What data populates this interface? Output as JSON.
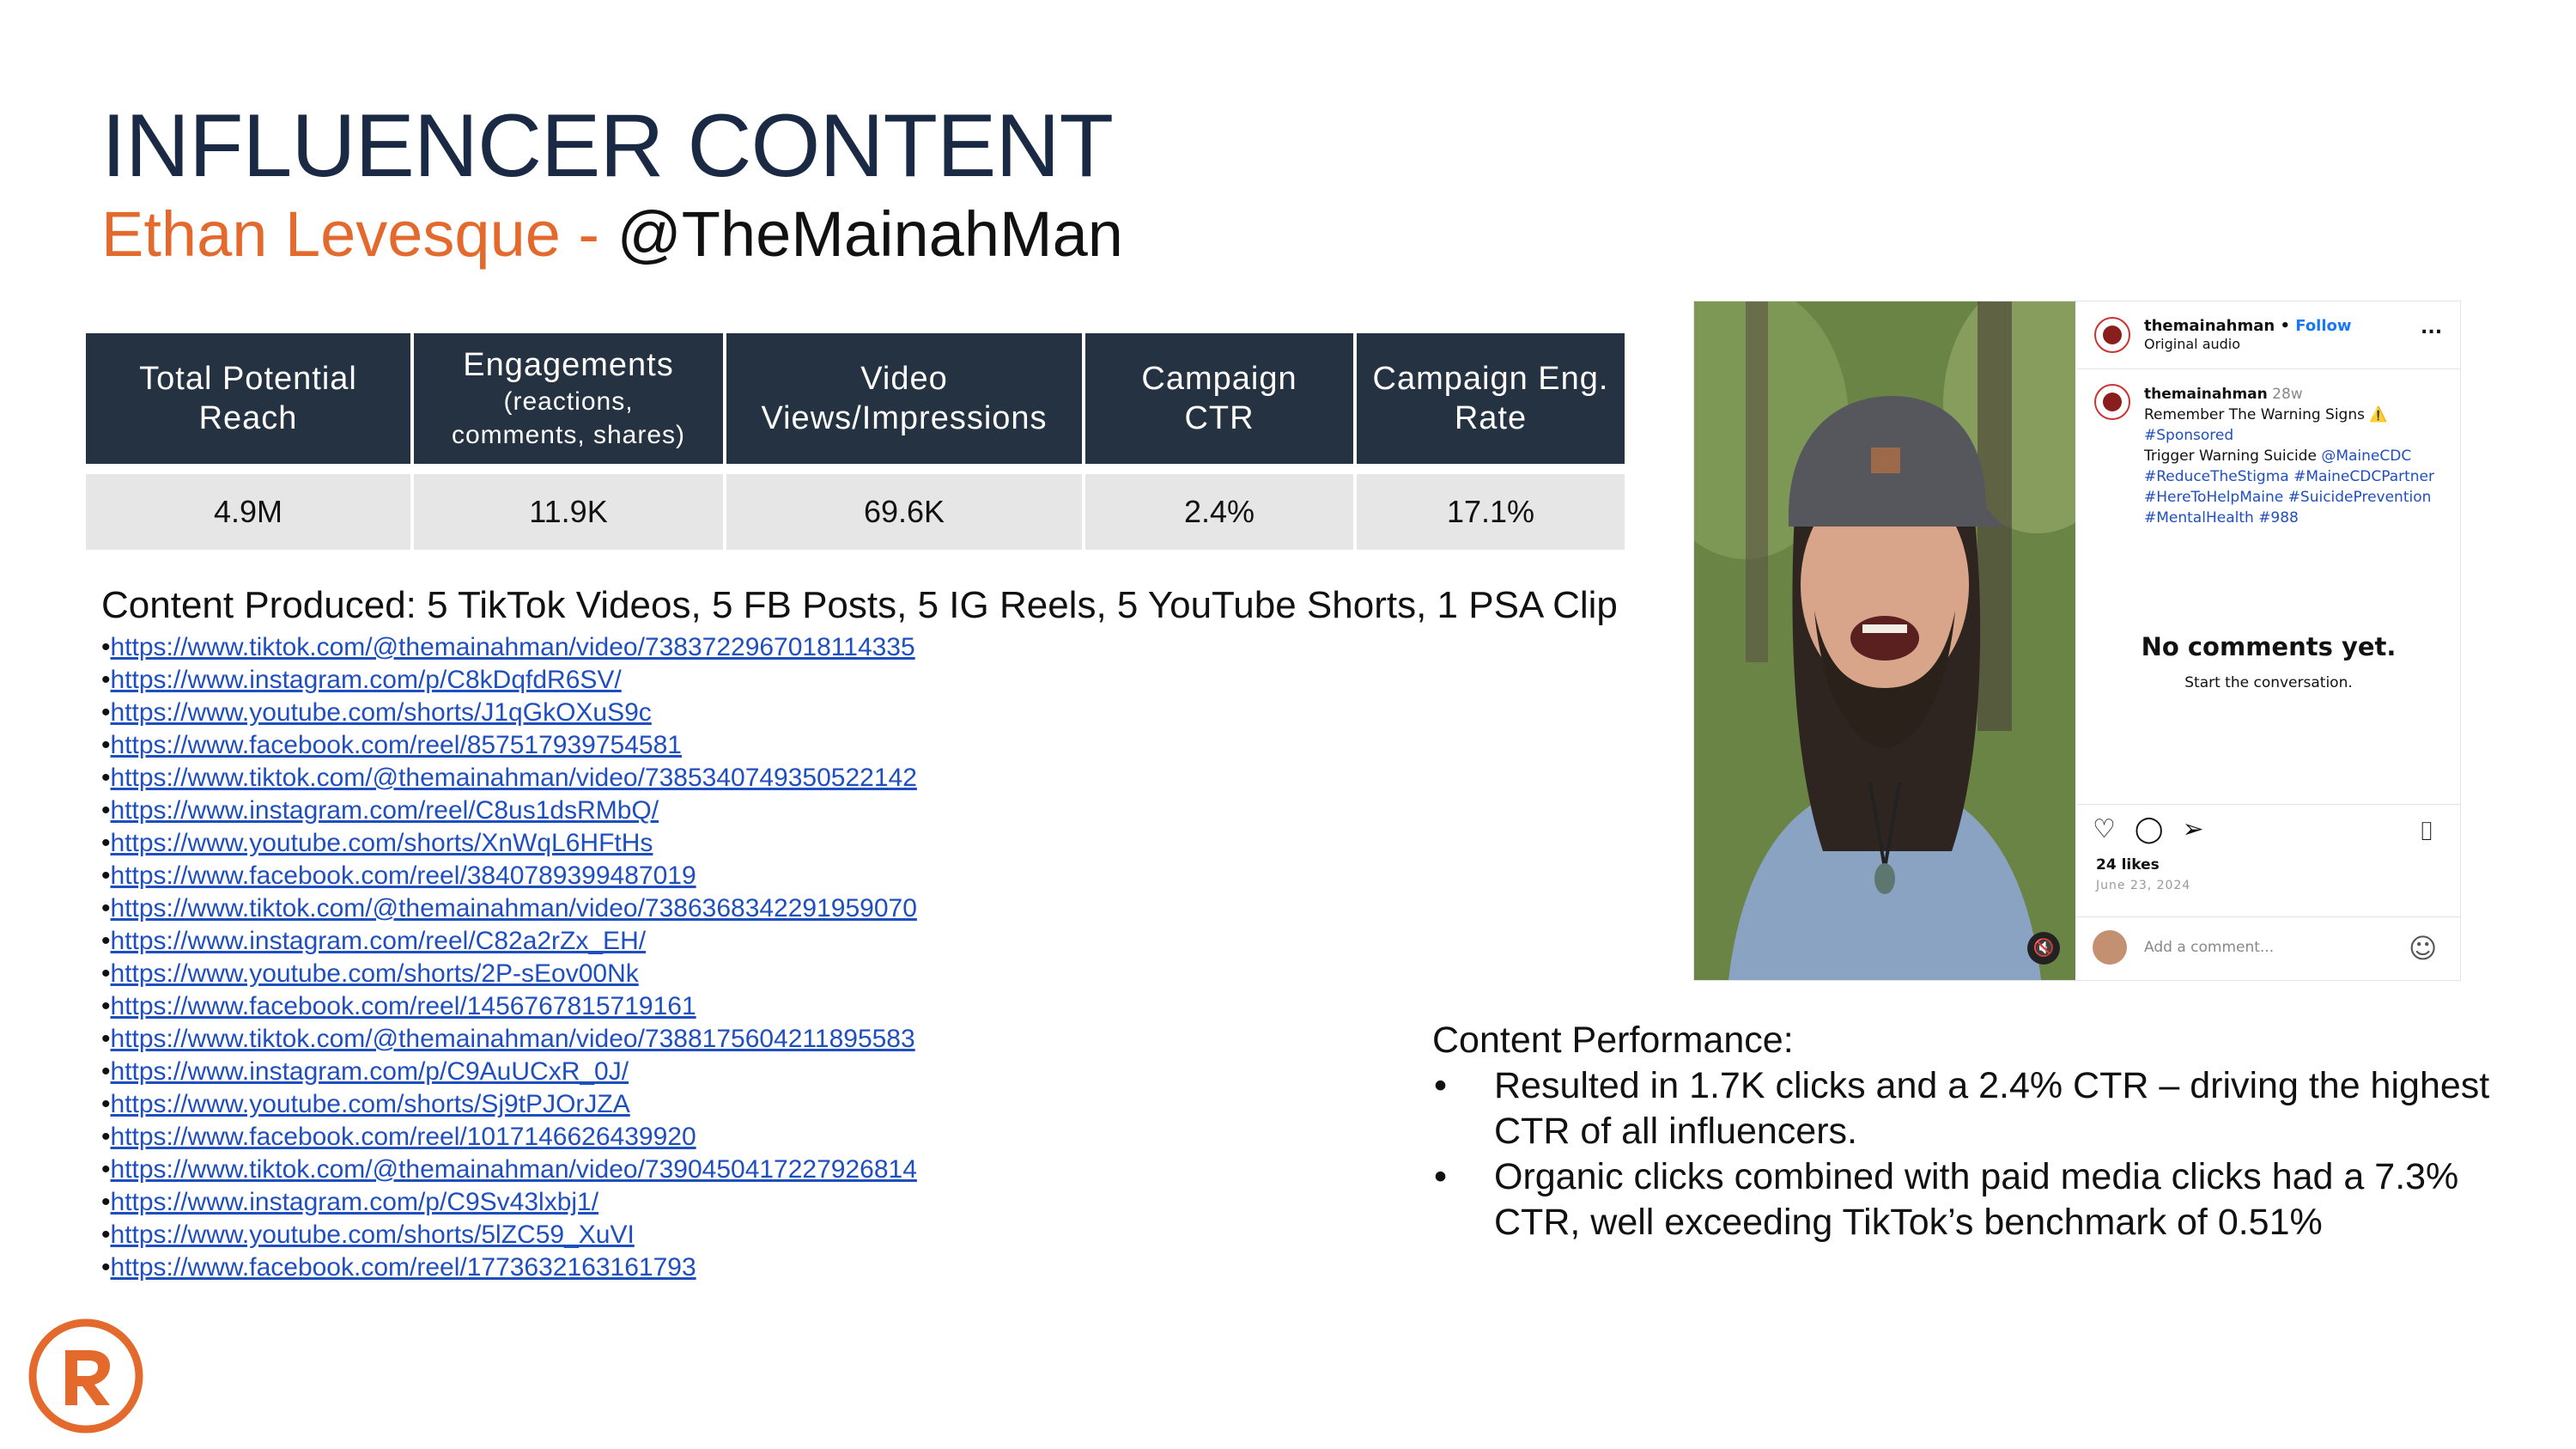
{
  "header": {
    "title": "INFLUENCER CONTENT",
    "name": "Ethan Levesque - ",
    "handle": "@TheMainahMan"
  },
  "stats": {
    "headers": [
      {
        "line1": "Total Potential",
        "line2": "Reach"
      },
      {
        "line1": "Engagements",
        "small1": "(reactions,",
        "small2": "comments, shares)"
      },
      {
        "line1": "Video",
        "line2": "Views/Impressions"
      },
      {
        "line1": "Campaign",
        "line2": "CTR"
      },
      {
        "line1": "Campaign Eng.",
        "line2": "Rate"
      }
    ],
    "values": [
      "4.9M",
      "11.9K",
      "69.6K",
      "2.4%",
      "17.1%"
    ]
  },
  "content": {
    "heading": "Content Produced: 5 TikTok Videos, 5 FB Posts, 5 IG Reels, 5 YouTube Shorts, 1 PSA Clip",
    "bullet": "•",
    "links": [
      "https://www.tiktok.com/@themainahman/video/7383722967018114335",
      "https://www.instagram.com/p/C8kDqfdR6SV/",
      "https://www.youtube.com/shorts/J1qGkOXuS9c",
      "https://www.facebook.com/reel/857517939754581",
      "https://www.tiktok.com/@themainahman/video/7385340749350522142",
      "https://www.instagram.com/reel/C8us1dsRMbQ/",
      "https://www.youtube.com/shorts/XnWqL6HFtHs",
      "https://www.facebook.com/reel/3840789399487019",
      "https://www.tiktok.com/@themainahman/video/7386368342291959070",
      "https://www.instagram.com/reel/C82a2rZx_EH/",
      "https://www.youtube.com/shorts/2P-sEov00Nk",
      "https://www.facebook.com/reel/1456767815719161",
      "https://www.tiktok.com/@themainahman/video/7388175604211895583",
      "https://www.instagram.com/p/C9AuUCxR_0J/",
      "https://www.youtube.com/shorts/Sj9tPJOrJZA",
      "https://www.facebook.com/reel/1017146626439920",
      "https://www.tiktok.com/@themainahman/video/7390450417227926814",
      "https://www.instagram.com/p/C9Sv43lxbj1/",
      "https://www.youtube.com/shorts/5lZC59_XuVI",
      "https://www.facebook.com/reel/1773632163161793"
    ]
  },
  "post": {
    "username": "themainahman",
    "follow": "Follow",
    "audio": "Original audio",
    "more": "...",
    "caption_user": "themainahman",
    "caption_age": "28w",
    "caption_lines": [
      "Remember The Warning Signs ⚠️",
      "#Sponsored",
      "Trigger Warning Suicide",
      "#ReduceTheStigma #MaineCDCPartner",
      "#HereToHelpMaine #SuicidePrevention",
      "#MentalHealth #988"
    ],
    "mention": "@MaineCDC",
    "no_comments": "No comments yet.",
    "start": "Start the conversation.",
    "likes": "24 likes",
    "date": "June 23, 2024",
    "add_comment": "Add a comment...",
    "icon_heart": "♡",
    "icon_comment": "◯",
    "icon_share": "➢",
    "icon_bookmark": "⌷",
    "icon_smile": "☺",
    "icon_mute": "🔇"
  },
  "performance": {
    "heading": "Content Performance:",
    "bullet": "•",
    "points": [
      "Resulted in 1.7K clicks and a 2.4% CTR – driving the highest CTR of all influencers.",
      "Organic clicks combined with paid media clicks had a 7.3% CTR, well exceeding TikTok’s benchmark of 0.51%"
    ]
  },
  "colors": {
    "navy": "#1b2a44",
    "orange": "#e36a2c",
    "header_bg": "#253242",
    "cell_bg": "#e6e6e6",
    "link": "#1f4fbf"
  }
}
